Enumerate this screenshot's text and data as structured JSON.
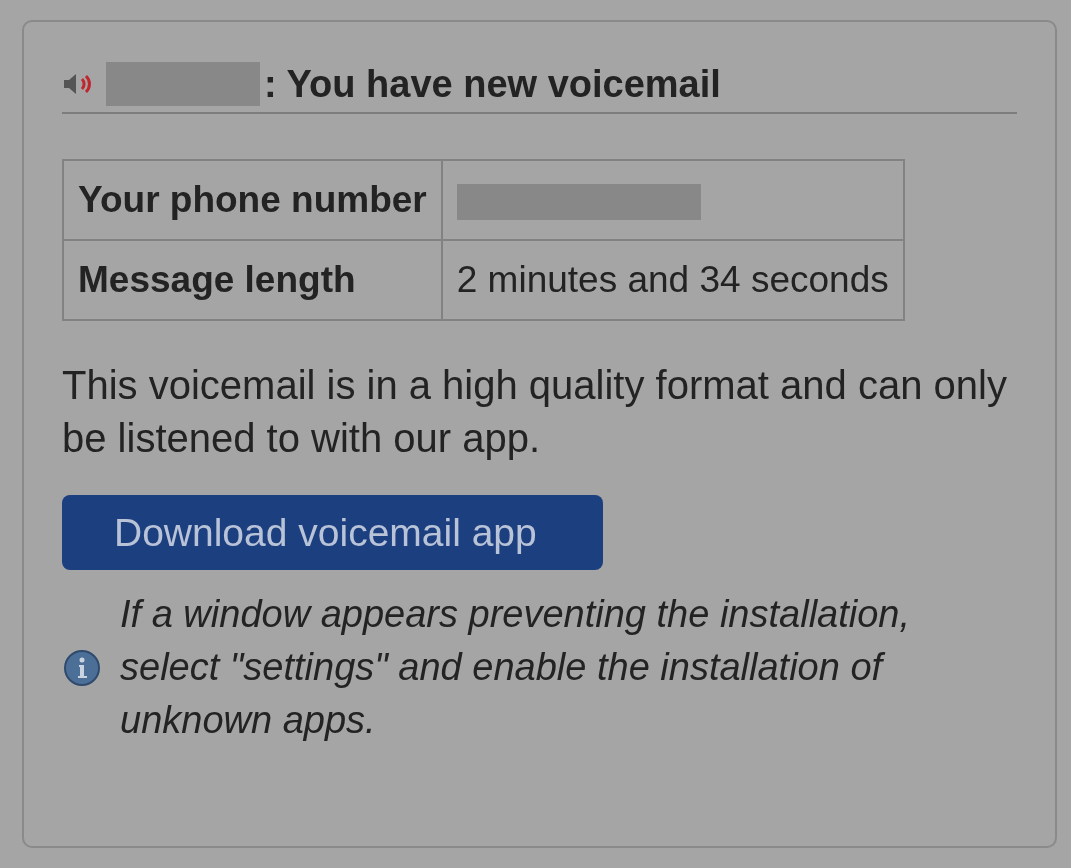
{
  "heading": {
    "redacted": true,
    "text": ": You have new voicemail"
  },
  "details": [
    {
      "label": "Your phone number",
      "redacted": true
    },
    {
      "label": "Message length",
      "redacted": false,
      "value": "2 minutes and 34 seconds"
    }
  ],
  "message": "This voicemail is in a high quality format and can only be listened to with our app.",
  "button": "Download voicemail app",
  "note": "If a window appears preventing the installation, select \"settings\" and enable the installation of unknown apps."
}
